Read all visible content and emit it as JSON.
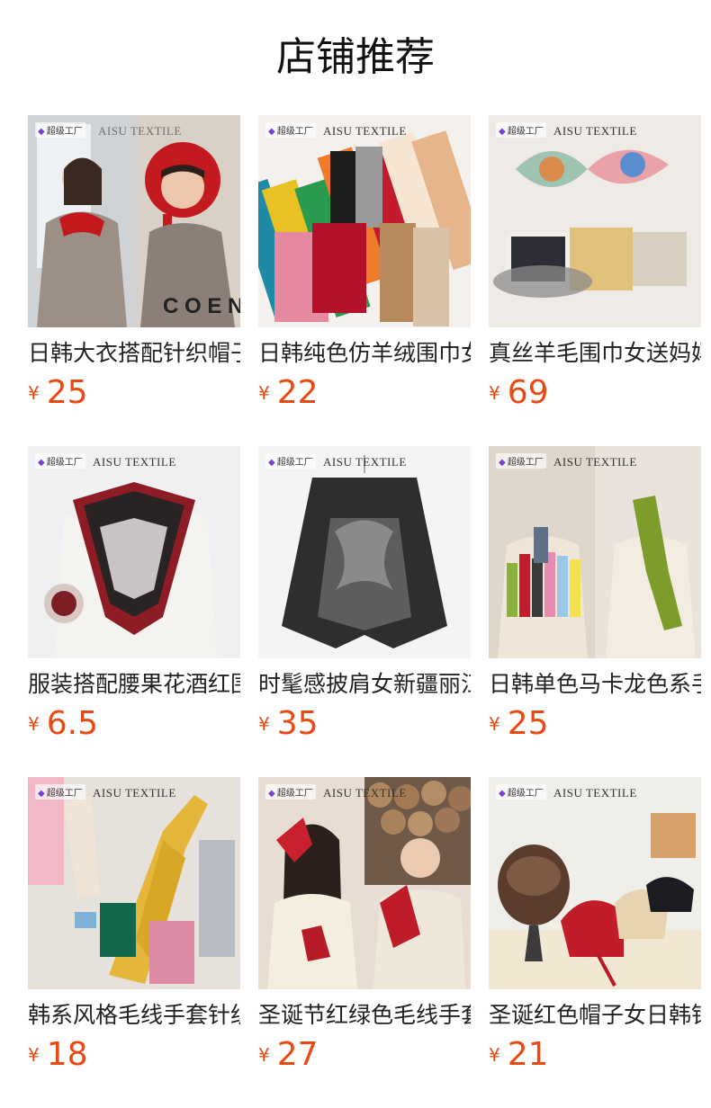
{
  "page": {
    "title": "店铺推荐"
  },
  "common": {
    "brand": "AISU TEXTILE",
    "brand_tag": "超级工厂",
    "currency": "¥"
  },
  "products": [
    {
      "name": "日韩大衣搭配针织帽子围巾一体",
      "price": "25",
      "theme": "hood"
    },
    {
      "name": "日韩纯色仿羊绒围巾女秋冬",
      "price": "22",
      "theme": "scarves"
    },
    {
      "name": "真丝羊毛围巾女送妈妈礼品",
      "price": "69",
      "theme": "silk"
    },
    {
      "name": "服装搭配腰果花酒红围巾",
      "price": "6.5",
      "theme": "bandana"
    },
    {
      "name": "时髦感披肩女新疆丽江旅游",
      "price": "35",
      "theme": "poncho"
    },
    {
      "name": "日韩单色马卡龙色系手套",
      "price": "25",
      "theme": "gloves"
    },
    {
      "name": "韩系风格毛线手套针织长款",
      "price": "18",
      "theme": "yellowgloves"
    },
    {
      "name": "圣诞节红绿色毛线手套女",
      "price": "27",
      "theme": "christmas"
    },
    {
      "name": "圣诞红色帽子女日韩针织",
      "price": "21",
      "theme": "hats"
    }
  ]
}
